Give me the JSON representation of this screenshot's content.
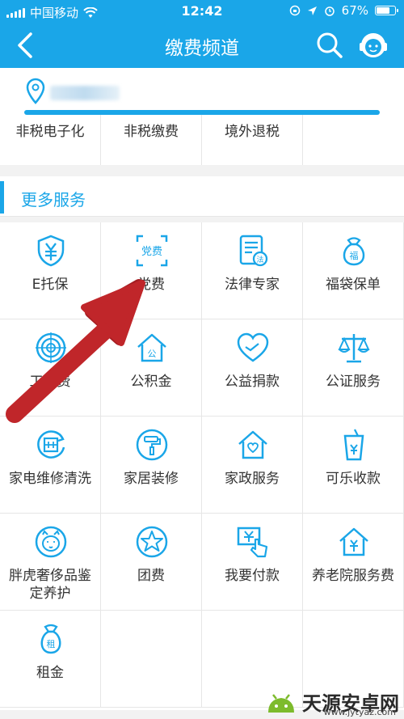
{
  "status_bar": {
    "carrier": "中国移动",
    "time": "12:42",
    "battery": "67%"
  },
  "nav": {
    "title": "缴费频道",
    "icons": [
      "back-arrow-icon",
      "search-icon",
      "customer-service-icon"
    ]
  },
  "location": {
    "icon": "location-pin-icon"
  },
  "top_row": [
    {
      "label": "非税电子化"
    },
    {
      "label": "非税缴费"
    },
    {
      "label": "境外退税"
    },
    {
      "label": ""
    }
  ],
  "section": {
    "title": "更多服务"
  },
  "services": [
    {
      "label": "E托保",
      "icon": "shield-yen-icon"
    },
    {
      "label": "党费",
      "icon": "party-fee-icon"
    },
    {
      "label": "法律专家",
      "icon": "law-document-icon"
    },
    {
      "label": "福袋保单",
      "icon": "lucky-bag-icon"
    },
    {
      "label": "工会费",
      "icon": "target-icon"
    },
    {
      "label": "公积金",
      "icon": "house-fund-icon"
    },
    {
      "label": "公益捐款",
      "icon": "heart-hand-icon"
    },
    {
      "label": "公证服务",
      "icon": "scales-icon"
    },
    {
      "label": "家电维修清洗",
      "icon": "appliance-repair-icon"
    },
    {
      "label": "家居装修",
      "icon": "paint-roller-icon"
    },
    {
      "label": "家政服务",
      "icon": "home-heart-icon"
    },
    {
      "label": "可乐收款",
      "icon": "cola-cup-icon"
    },
    {
      "label": "胖虎奢侈品鉴定养护",
      "icon": "tiger-face-icon"
    },
    {
      "label": "团费",
      "icon": "star-circle-icon"
    },
    {
      "label": "我要付款",
      "icon": "pay-tap-icon"
    },
    {
      "label": "养老院服务费",
      "icon": "nursing-home-icon"
    },
    {
      "label": "租金",
      "icon": "rent-bag-icon"
    }
  ],
  "watermark": {
    "brand": "天源安卓网",
    "url": "www.jytyaz.com"
  },
  "colors": {
    "accent": "#1aa6e8",
    "arrow": "#c0262a"
  }
}
